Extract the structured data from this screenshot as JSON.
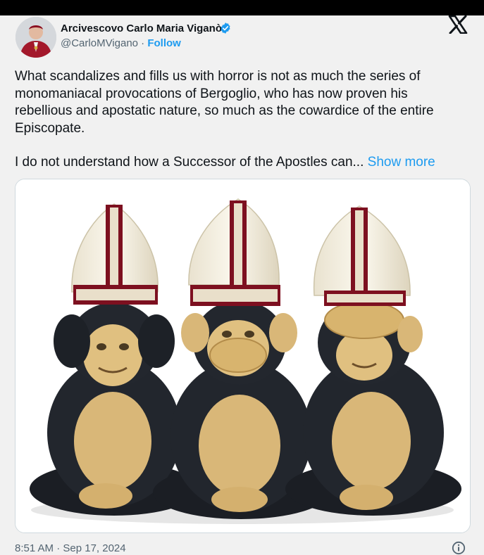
{
  "author": {
    "display_name": "Arcivescovo Carlo Maria Viganò",
    "handle": "@CarloMVigano",
    "separator": " · ",
    "follow_label": "Follow",
    "verified_icon": "verified-badge-icon",
    "verified_color": "#1d9bf0"
  },
  "platform_icon": "x-logo-icon",
  "tweet": {
    "paragraph_1": "What scandalizes and fills us with horror is not as much the series of monomaniacal provocations of Bergoglio, who has now proven his rebellious and apostatic nature, so much as the cowardice of the entire Episcopate.",
    "paragraph_2": "I do not understand how a Successor of the Apostles can... ",
    "show_more_label": "Show more"
  },
  "timestamp": "8:51 AM · Sep 17, 2024",
  "info_icon": "info-icon",
  "colors": {
    "accent": "#1d9bf0",
    "text": "#0f1419",
    "secondary_text": "#536471",
    "background": "#f1f1f1"
  }
}
